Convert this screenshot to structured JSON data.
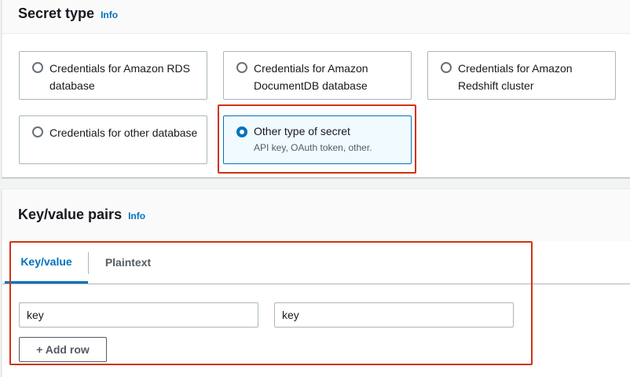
{
  "secret_type": {
    "title": "Secret type",
    "info": "Info",
    "options": [
      {
        "label": "Credentials for Amazon RDS database",
        "selected": false
      },
      {
        "label": "Credentials for Amazon DocumentDB database",
        "selected": false
      },
      {
        "label": "Credentials for Amazon Redshift cluster",
        "selected": false
      },
      {
        "label": "Credentials for other database",
        "selected": false
      },
      {
        "label": "Other type of secret",
        "description": "API key, OAuth token, other.",
        "selected": true
      }
    ]
  },
  "key_value": {
    "title": "Key/value pairs",
    "info": "Info",
    "tabs": [
      {
        "label": "Key/value",
        "active": true
      },
      {
        "label": "Plaintext",
        "active": false
      }
    ],
    "row": {
      "key_value": "key",
      "value_value": "key"
    },
    "add_row_label": "+ Add row"
  },
  "colors": {
    "accent": "#0073bb",
    "highlight": "#d13212",
    "selected_background": "#f1faff"
  }
}
